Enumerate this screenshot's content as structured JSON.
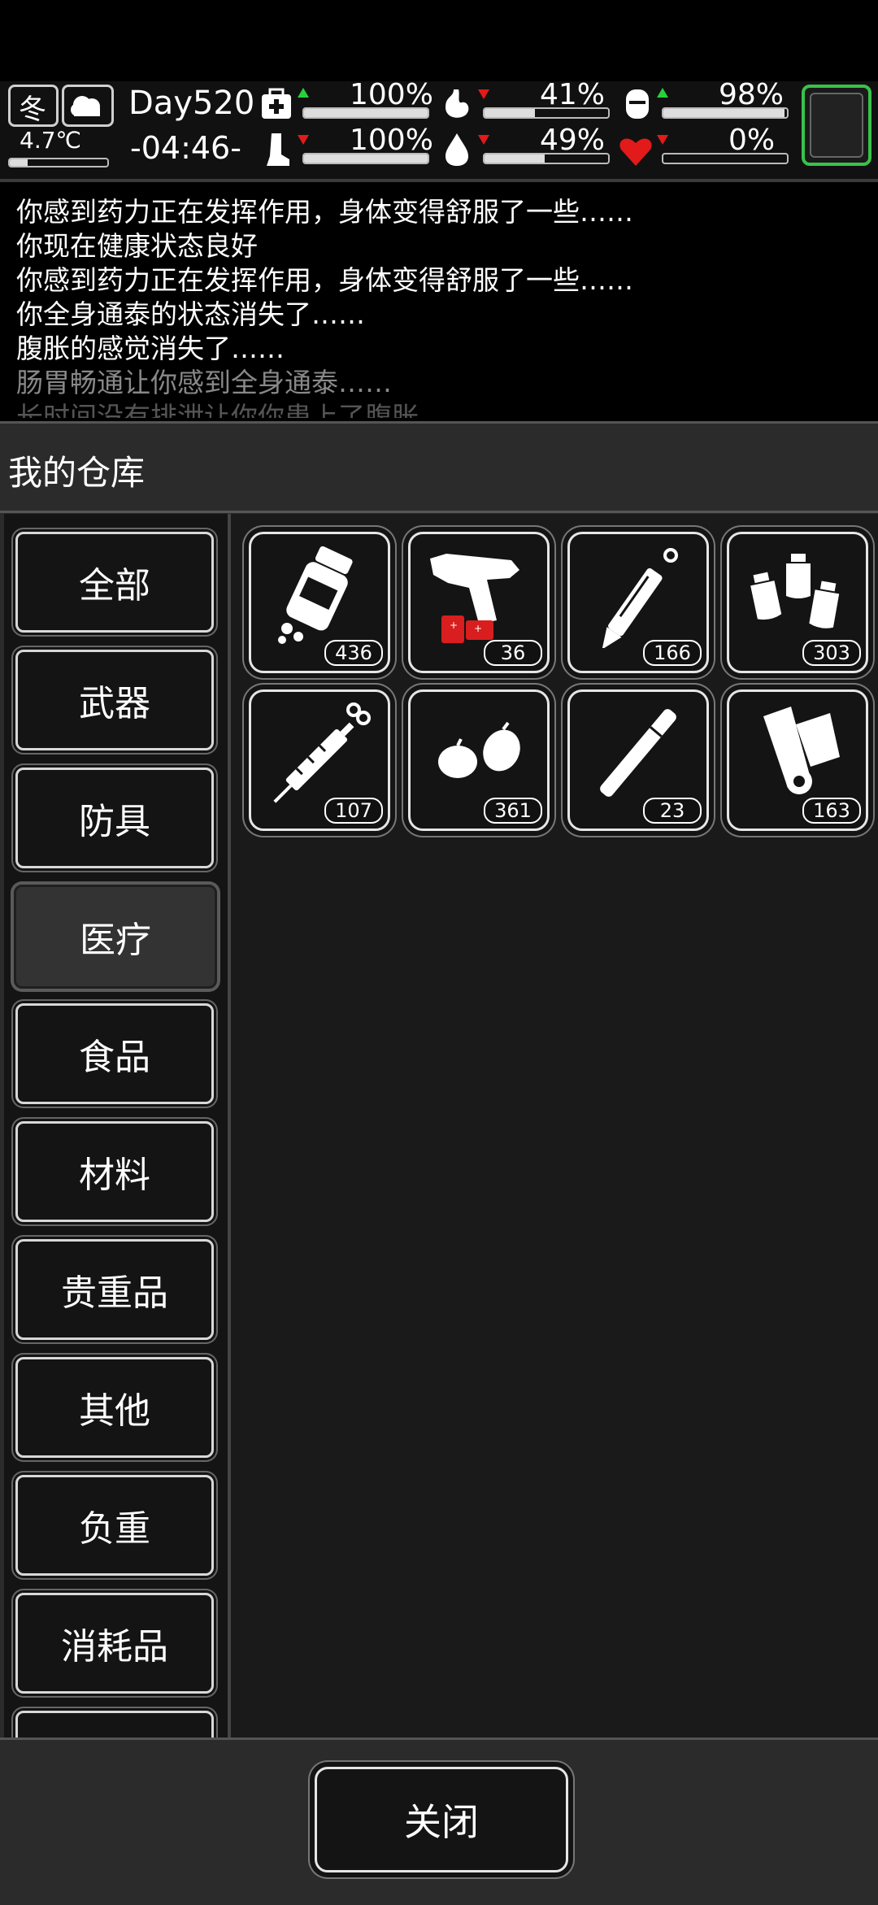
{
  "hud": {
    "season": "冬",
    "temperature": "4.7℃",
    "day": "Day520",
    "time": "-04:46-",
    "stats": [
      {
        "name": "health",
        "icon": "medkit-icon",
        "value": "100%",
        "level": 1.0,
        "trend": "up"
      },
      {
        "name": "hunger",
        "icon": "stomach-icon",
        "value": "41%",
        "level": 0.41,
        "trend": "down"
      },
      {
        "name": "mood",
        "icon": "pill-icon",
        "value": "98%",
        "level": 0.98,
        "trend": "up"
      },
      {
        "name": "stamina",
        "icon": "leg-icon",
        "value": "100%",
        "level": 1.0,
        "trend": "down"
      },
      {
        "name": "thirst",
        "icon": "water-drop-icon",
        "value": "49%",
        "level": 0.49,
        "trend": "down"
      },
      {
        "name": "heart",
        "icon": "heart-icon",
        "value": "0%",
        "level": 0.0,
        "trend": "down"
      }
    ],
    "colors": {
      "up": "#28d13a",
      "down": "#e21a1a",
      "slot_frame": "#39c24a",
      "heart": "#e21a1a"
    }
  },
  "log": [
    "你感到药力正在发挥作用，身体变得舒服了一些……",
    "你现在健康状态良好",
    "你感到药力正在发挥作用，身体变得舒服了一些……",
    "你全身通泰的状态消失了……",
    "腹胀的感觉消失了……",
    "肠胃畅通让你感到全身通泰……",
    "长时间没有排泄让你你患上了腹胀"
  ],
  "panel": {
    "title": "我的仓库",
    "categories": [
      "全部",
      "武器",
      "防具",
      "医疗",
      "食品",
      "材料",
      "贵重品",
      "其他",
      "负重",
      "消耗品"
    ],
    "selected": "医疗",
    "items": [
      {
        "icon": "pill-bottle-icon",
        "count": "436"
      },
      {
        "icon": "flare-gun-icon",
        "count": "36"
      },
      {
        "icon": "scalpel-icon",
        "count": "166"
      },
      {
        "icon": "vials-icon",
        "count": "303"
      },
      {
        "icon": "syringe-icon",
        "count": "107"
      },
      {
        "icon": "seeds-icon",
        "count": "361"
      },
      {
        "icon": "cigarette-icon",
        "count": "23"
      },
      {
        "icon": "bandage-roll-icon",
        "count": "163"
      }
    ]
  },
  "footer": {
    "close_label": "关闭"
  }
}
